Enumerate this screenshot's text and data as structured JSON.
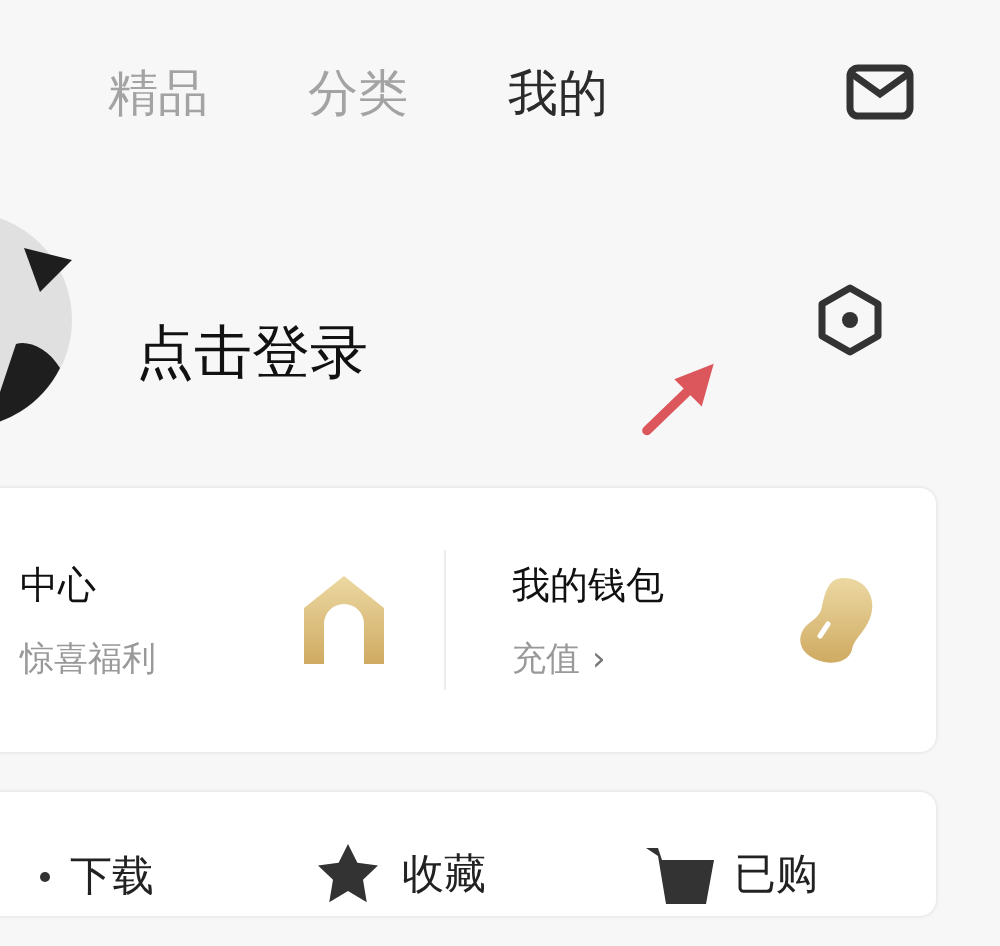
{
  "tabs": [
    {
      "label": "精品",
      "selected": false
    },
    {
      "label": "分类",
      "selected": false
    },
    {
      "label": "我的",
      "selected": true
    }
  ],
  "profile": {
    "login": "点击登录"
  },
  "features": [
    {
      "kind": "house",
      "title": "中心",
      "subtitle": "惊喜福利"
    },
    {
      "kind": "bean",
      "title": "我的钱包",
      "subtitle": "充值",
      "chevron": "›"
    }
  ],
  "shortcuts": [
    {
      "kind": "download",
      "label": "下载"
    },
    {
      "kind": "star",
      "label": "收藏"
    },
    {
      "kind": "cart",
      "label": "已购"
    }
  ]
}
